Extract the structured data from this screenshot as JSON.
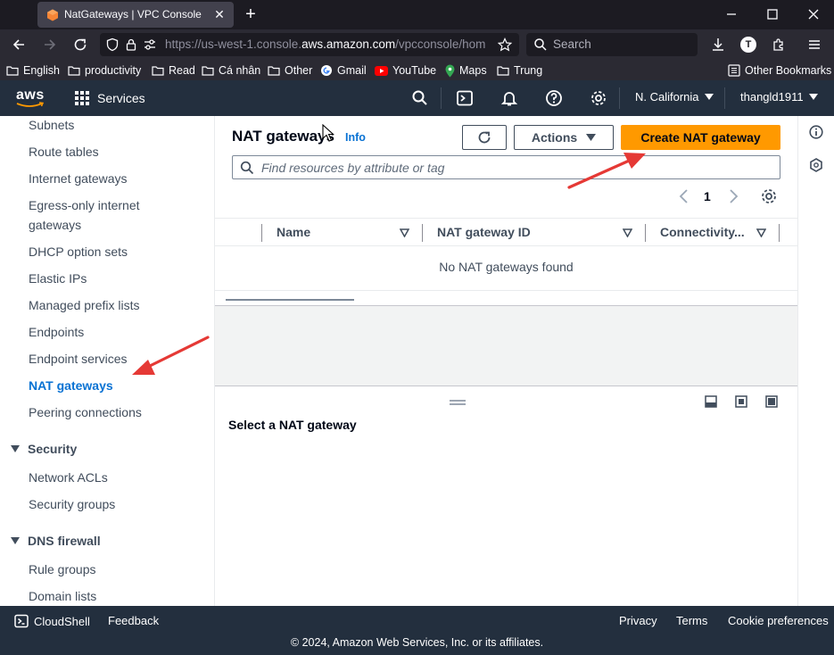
{
  "browser": {
    "tab_title": "NatGateways | VPC Console",
    "url_prefix": "https://us-west-1.console.",
    "url_host": "aws.amazon.com",
    "url_rest": "/vpcconsole/hom",
    "search_placeholder": "Search",
    "profile_initial": "T",
    "bookmarks": [
      "English",
      "productivity",
      "Read",
      "Cá nhân",
      "Other",
      "Gmail",
      "YouTube",
      "Maps",
      "Trung"
    ],
    "other_bookmarks": "Other Bookmarks"
  },
  "aws_header": {
    "logo_text": "aws",
    "services_label": "Services",
    "region": "N. California",
    "user": "thangld1911"
  },
  "sidebar": {
    "items": [
      {
        "label": "Subnets"
      },
      {
        "label": "Route tables"
      },
      {
        "label": "Internet gateways"
      },
      {
        "label": "Egress-only internet gateways"
      },
      {
        "label": "DHCP option sets"
      },
      {
        "label": "Elastic IPs"
      },
      {
        "label": "Managed prefix lists"
      },
      {
        "label": "Endpoints"
      },
      {
        "label": "Endpoint services"
      },
      {
        "label": "NAT gateways",
        "active": true
      },
      {
        "label": "Peering connections"
      }
    ],
    "security_section": "Security",
    "security_items": [
      {
        "label": "Network ACLs"
      },
      {
        "label": "Security groups"
      }
    ],
    "dns_section": "DNS firewall",
    "dns_items": [
      {
        "label": "Rule groups"
      },
      {
        "label": "Domain lists"
      }
    ]
  },
  "main": {
    "title": "NAT gateways",
    "info_label": "Info",
    "actions_label": "Actions",
    "create_label": "Create NAT gateway",
    "filter_placeholder": "Find resources by attribute or tag",
    "page_number": "1",
    "columns": [
      "Name",
      "NAT gateway ID",
      "Connectivity..."
    ],
    "empty_message": "No NAT gateways found",
    "detail_title": "Select a NAT gateway"
  },
  "footer": {
    "cloudshell": "CloudShell",
    "feedback": "Feedback",
    "privacy": "Privacy",
    "terms": "Terms",
    "cookie_preferences": "Cookie preferences",
    "copyright": "© 2024, Amazon Web Services, Inc. or its affiliates."
  },
  "colors": {
    "aws_nav": "#232f3e",
    "accent_orange": "#ff9900",
    "link_blue": "#0972d3",
    "annotation_red": "#e53935"
  }
}
